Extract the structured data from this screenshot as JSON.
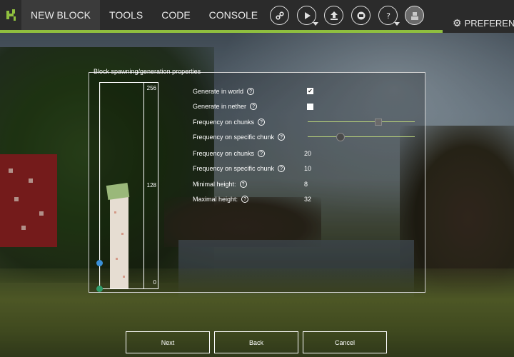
{
  "menu": {
    "tabs": [
      {
        "label": "NEW BLOCK",
        "active": true
      },
      {
        "label": "TOOLS",
        "active": false
      },
      {
        "label": "CODE",
        "active": false
      },
      {
        "label": "CONSOLE",
        "active": false
      }
    ],
    "preferences_label": "PREFEREN"
  },
  "toolbar": {
    "icons": [
      "link-icon",
      "play-dropdown-icon",
      "export-icon",
      "workspace-icon",
      "help-dropdown-icon",
      "user-avatar-icon"
    ]
  },
  "panel": {
    "legend": "Block spawning/generation properties",
    "height_scale": {
      "top": "256",
      "middle": "128",
      "bottom": "0"
    },
    "height_range": {
      "min": 0,
      "max": 256,
      "handle_low": 0,
      "handle_high": 32
    },
    "properties": [
      {
        "label": "Generate in world",
        "control": "checkbox",
        "checked": true
      },
      {
        "label": "Generate in nether",
        "control": "checkbox",
        "checked": false
      },
      {
        "label": "Frequency on chunks",
        "control": "slider",
        "fraction": 0.66
      },
      {
        "label": "Frequency on specific chunk",
        "control": "slider",
        "fraction": 0.3
      },
      {
        "label": "Frequency on chunks",
        "control": "value",
        "value": "20"
      },
      {
        "label": "Frequency on specific chunk",
        "control": "value",
        "value": "10"
      },
      {
        "label": "Minimal height:",
        "control": "value",
        "value": "8"
      },
      {
        "label": "Maximal height:",
        "control": "value",
        "value": "32"
      }
    ],
    "help_glyph": "?"
  },
  "buttons": {
    "next": "Next",
    "back": "Back",
    "cancel": "Cancel"
  },
  "colors": {
    "accent_green": "#8fbf3f",
    "topbar": "#2b2b2b",
    "low_handle": "#2f9c6a",
    "high_handle": "#3a8fd8"
  }
}
